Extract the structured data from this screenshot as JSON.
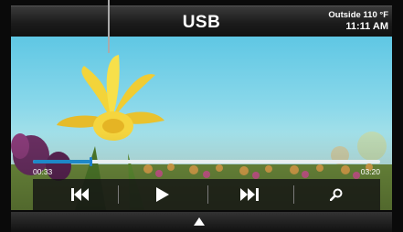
{
  "header": {
    "title": "USB",
    "outside_label": "Outside 110 °F",
    "clock": "11:11 AM"
  },
  "player": {
    "elapsed": "00:33",
    "total": "03:20",
    "progress_fraction": 0.165,
    "controls": {
      "previous_icon": "skip-previous-icon",
      "play_icon": "play-icon",
      "next_icon": "skip-next-icon",
      "search_icon": "search-icon"
    }
  },
  "footer": {
    "expand_icon": "up-arrow-icon"
  },
  "colors": {
    "progress_fill": "#1e88c8",
    "bar_bg": "#141414",
    "text": "#ffffff"
  }
}
